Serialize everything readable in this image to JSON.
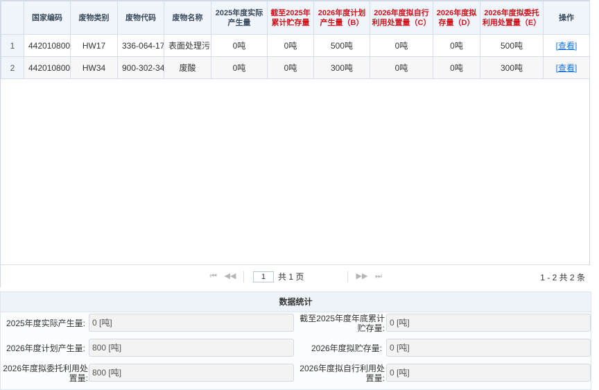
{
  "grid": {
    "headers": {
      "code": "国家编码",
      "type": "废物类别",
      "wcode": "废物代码",
      "name": "废物名称",
      "actual2025": "2025年度实际产生量",
      "stock2025": "截至2025年累计贮存量",
      "plan2026": "2026年度计划产生量（B）",
      "self2026": "2026年度拟自行利用处置量（C）",
      "store2026": "2026年度拟存量（D）",
      "entrust2026": "2026年度拟委托利用处置量（E）",
      "op": "操作"
    },
    "rows": [
      {
        "idx": "1",
        "code": "442010800",
        "type": "HW17",
        "wcode": "336-064-17",
        "name": "表面处理污",
        "actual2025": "0吨",
        "stock2025": "0吨",
        "plan2026": "500吨",
        "self2026": "0吨",
        "store2026": "0吨",
        "entrust2026": "500吨",
        "op": "[查看]"
      },
      {
        "idx": "2",
        "code": "442010800",
        "type": "HW34",
        "wcode": "900-302-34",
        "name": "废酸",
        "actual2025": "0吨",
        "stock2025": "0吨",
        "plan2026": "300吨",
        "self2026": "0吨",
        "store2026": "0吨",
        "entrust2026": "300吨",
        "op": "[查看]"
      }
    ]
  },
  "pager": {
    "page": "1",
    "total_pages": "共 1 页",
    "info": "1 - 2 共 2 条",
    "icons": {
      "first": "⏮",
      "prev": "◀◀",
      "next": "▶▶",
      "last": "⏭"
    }
  },
  "stats": {
    "title": "数据统计",
    "f1_label": "2025年度实际产生量:",
    "f1_value": "0 [吨]",
    "f2_label": "截至2025年度年底累计贮存量:",
    "f2_value": "0 [吨]",
    "f3_label": "2026年度计划产生量:",
    "f3_value": "800 [吨]",
    "f4_label": "2026年度拟贮存量:",
    "f4_value": "0 [吨]",
    "f5_label": "2026年度拟委托利用处置量:",
    "f5_value": "800 [吨]",
    "f6_label": "2026年度拟自行利用处置量:",
    "f6_value": "0 [吨]"
  }
}
